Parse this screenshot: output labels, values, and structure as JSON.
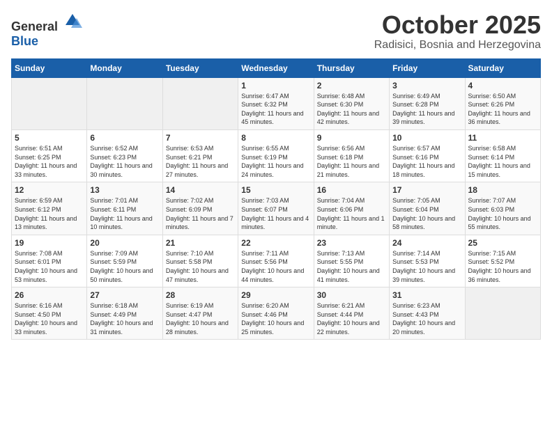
{
  "header": {
    "logo_general": "General",
    "logo_blue": "Blue",
    "month": "October 2025",
    "location": "Radisici, Bosnia and Herzegovina"
  },
  "weekdays": [
    "Sunday",
    "Monday",
    "Tuesday",
    "Wednesday",
    "Thursday",
    "Friday",
    "Saturday"
  ],
  "weeks": [
    [
      {
        "day": "",
        "empty": true
      },
      {
        "day": "",
        "empty": true
      },
      {
        "day": "",
        "empty": true
      },
      {
        "day": "1",
        "sunrise": "6:47 AM",
        "sunset": "6:32 PM",
        "daylight": "11 hours and 45 minutes."
      },
      {
        "day": "2",
        "sunrise": "6:48 AM",
        "sunset": "6:30 PM",
        "daylight": "11 hours and 42 minutes."
      },
      {
        "day": "3",
        "sunrise": "6:49 AM",
        "sunset": "6:28 PM",
        "daylight": "11 hours and 39 minutes."
      },
      {
        "day": "4",
        "sunrise": "6:50 AM",
        "sunset": "6:26 PM",
        "daylight": "11 hours and 36 minutes."
      }
    ],
    [
      {
        "day": "5",
        "sunrise": "6:51 AM",
        "sunset": "6:25 PM",
        "daylight": "11 hours and 33 minutes."
      },
      {
        "day": "6",
        "sunrise": "6:52 AM",
        "sunset": "6:23 PM",
        "daylight": "11 hours and 30 minutes."
      },
      {
        "day": "7",
        "sunrise": "6:53 AM",
        "sunset": "6:21 PM",
        "daylight": "11 hours and 27 minutes."
      },
      {
        "day": "8",
        "sunrise": "6:55 AM",
        "sunset": "6:19 PM",
        "daylight": "11 hours and 24 minutes."
      },
      {
        "day": "9",
        "sunrise": "6:56 AM",
        "sunset": "6:18 PM",
        "daylight": "11 hours and 21 minutes."
      },
      {
        "day": "10",
        "sunrise": "6:57 AM",
        "sunset": "6:16 PM",
        "daylight": "11 hours and 18 minutes."
      },
      {
        "day": "11",
        "sunrise": "6:58 AM",
        "sunset": "6:14 PM",
        "daylight": "11 hours and 15 minutes."
      }
    ],
    [
      {
        "day": "12",
        "sunrise": "6:59 AM",
        "sunset": "6:12 PM",
        "daylight": "11 hours and 13 minutes."
      },
      {
        "day": "13",
        "sunrise": "7:01 AM",
        "sunset": "6:11 PM",
        "daylight": "11 hours and 10 minutes."
      },
      {
        "day": "14",
        "sunrise": "7:02 AM",
        "sunset": "6:09 PM",
        "daylight": "11 hours and 7 minutes."
      },
      {
        "day": "15",
        "sunrise": "7:03 AM",
        "sunset": "6:07 PM",
        "daylight": "11 hours and 4 minutes."
      },
      {
        "day": "16",
        "sunrise": "7:04 AM",
        "sunset": "6:06 PM",
        "daylight": "11 hours and 1 minute."
      },
      {
        "day": "17",
        "sunrise": "7:05 AM",
        "sunset": "6:04 PM",
        "daylight": "10 hours and 58 minutes."
      },
      {
        "day": "18",
        "sunrise": "7:07 AM",
        "sunset": "6:03 PM",
        "daylight": "10 hours and 55 minutes."
      }
    ],
    [
      {
        "day": "19",
        "sunrise": "7:08 AM",
        "sunset": "6:01 PM",
        "daylight": "10 hours and 53 minutes."
      },
      {
        "day": "20",
        "sunrise": "7:09 AM",
        "sunset": "5:59 PM",
        "daylight": "10 hours and 50 minutes."
      },
      {
        "day": "21",
        "sunrise": "7:10 AM",
        "sunset": "5:58 PM",
        "daylight": "10 hours and 47 minutes."
      },
      {
        "day": "22",
        "sunrise": "7:11 AM",
        "sunset": "5:56 PM",
        "daylight": "10 hours and 44 minutes."
      },
      {
        "day": "23",
        "sunrise": "7:13 AM",
        "sunset": "5:55 PM",
        "daylight": "10 hours and 41 minutes."
      },
      {
        "day": "24",
        "sunrise": "7:14 AM",
        "sunset": "5:53 PM",
        "daylight": "10 hours and 39 minutes."
      },
      {
        "day": "25",
        "sunrise": "7:15 AM",
        "sunset": "5:52 PM",
        "daylight": "10 hours and 36 minutes."
      }
    ],
    [
      {
        "day": "26",
        "sunrise": "6:16 AM",
        "sunset": "4:50 PM",
        "daylight": "10 hours and 33 minutes."
      },
      {
        "day": "27",
        "sunrise": "6:18 AM",
        "sunset": "4:49 PM",
        "daylight": "10 hours and 31 minutes."
      },
      {
        "day": "28",
        "sunrise": "6:19 AM",
        "sunset": "4:47 PM",
        "daylight": "10 hours and 28 minutes."
      },
      {
        "day": "29",
        "sunrise": "6:20 AM",
        "sunset": "4:46 PM",
        "daylight": "10 hours and 25 minutes."
      },
      {
        "day": "30",
        "sunrise": "6:21 AM",
        "sunset": "4:44 PM",
        "daylight": "10 hours and 22 minutes."
      },
      {
        "day": "31",
        "sunrise": "6:23 AM",
        "sunset": "4:43 PM",
        "daylight": "10 hours and 20 minutes."
      },
      {
        "day": "",
        "empty": true
      }
    ]
  ]
}
